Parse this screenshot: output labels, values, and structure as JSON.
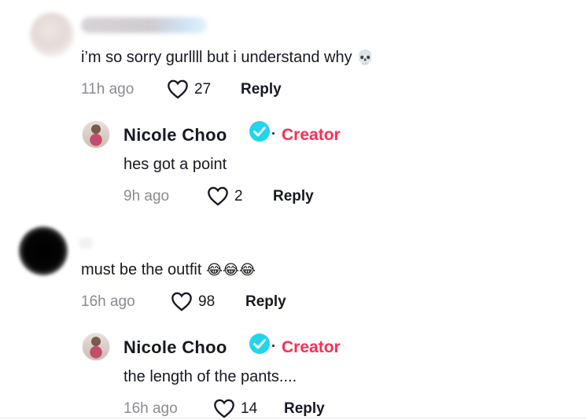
{
  "comments": [
    {
      "text": "i’m so sorry gurllll but i understand why",
      "emoji": "💀",
      "time": "11h ago",
      "likes": "27",
      "reply_label": "Reply",
      "replies": [
        {
          "name": "Nicole Choo",
          "badge": "Creator",
          "separator": "·",
          "text": "hes got a point",
          "time": "9h ago",
          "likes": "2",
          "reply_label": "Reply"
        }
      ]
    },
    {
      "text": "must be the outfit",
      "emoji": "😂😂😂",
      "time": "16h ago",
      "likes": "98",
      "reply_label": "Reply",
      "replies": [
        {
          "name": "Nicole Choo",
          "badge": "Creator",
          "separator": "·",
          "text": "the length of the pants....",
          "time": "16h ago",
          "likes": "14",
          "reply_label": "Reply"
        }
      ]
    }
  ],
  "icons": {
    "like": "heart-outline-icon",
    "verified": "verified-check-icon"
  },
  "colors": {
    "creator_accent": "#fe2c55",
    "verified_blue": "#20d5ec",
    "muted": "#8a8b91"
  }
}
